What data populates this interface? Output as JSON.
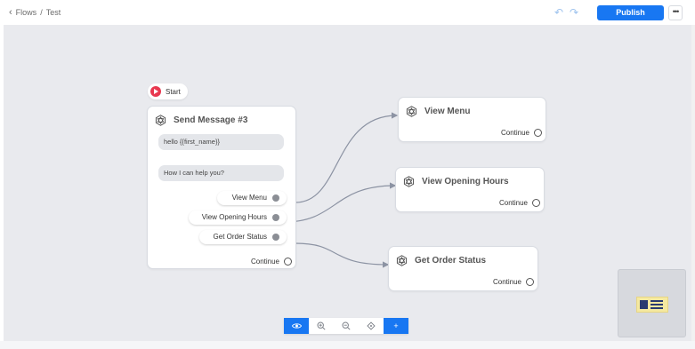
{
  "breadcrumb": {
    "back_label": "Flows",
    "separator": "/",
    "current": "Test"
  },
  "header": {
    "publish_label": "Publish",
    "more_label": "•••"
  },
  "start_label": "Start",
  "main_node": {
    "title": "Send Message #3",
    "messages": [
      "hello {{first_name}}",
      "How I can help you?"
    ],
    "buttons": [
      "View Menu",
      "View Opening Hours",
      "Get Order Status"
    ],
    "continue_label": "Continue"
  },
  "nodes": [
    {
      "title": "View Menu",
      "continue_label": "Continue"
    },
    {
      "title": "View Opening Hours",
      "continue_label": "Continue"
    },
    {
      "title": "Get Order Status",
      "continue_label": "Continue"
    }
  ],
  "toolbar": {
    "items": [
      "eye-icon",
      "zoom-in-icon",
      "zoom-out-icon",
      "fit-view-icon",
      "plus-icon"
    ],
    "add_label": "+"
  },
  "colors": {
    "accent": "#1877f2",
    "canvas": "#e9eaee",
    "start": "#e8384f",
    "edge": "#8c93a3"
  }
}
